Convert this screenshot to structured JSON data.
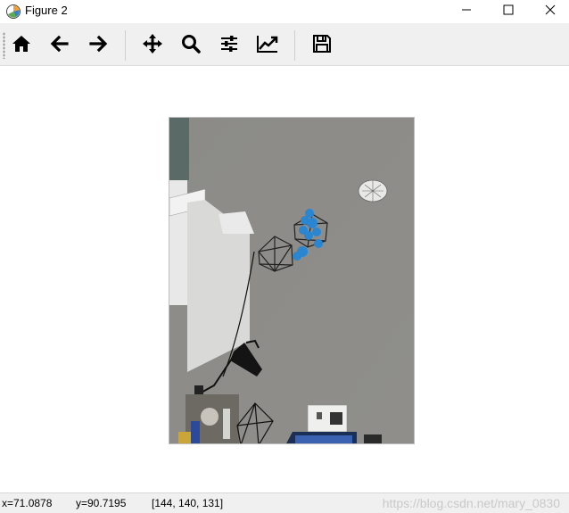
{
  "window": {
    "title": "Figure 2",
    "icon": "matplotlib-icon",
    "controls": [
      "minimize-icon",
      "maximize-icon",
      "close-icon"
    ]
  },
  "toolbar": {
    "buttons": [
      {
        "name": "home",
        "icon": "home-icon"
      },
      {
        "name": "back",
        "icon": "arrow-left-icon"
      },
      {
        "name": "forward",
        "icon": "arrow-right-icon"
      },
      {
        "name": "pan",
        "icon": "move-icon"
      },
      {
        "name": "zoom",
        "icon": "search-icon"
      },
      {
        "name": "subplots",
        "icon": "sliders-icon"
      },
      {
        "name": "edit-axes",
        "icon": "line-chart-icon"
      },
      {
        "name": "save",
        "icon": "floppy-disk-icon"
      }
    ]
  },
  "figure": {
    "image_description_colors": {
      "wall": "#8a8985",
      "marker": "#2a86d0"
    }
  },
  "status": {
    "x": "x=71.0878",
    "y": "y=90.7195",
    "pixel": "[144, 140, 131]"
  },
  "watermark": "https://blog.csdn.net/mary_0830"
}
